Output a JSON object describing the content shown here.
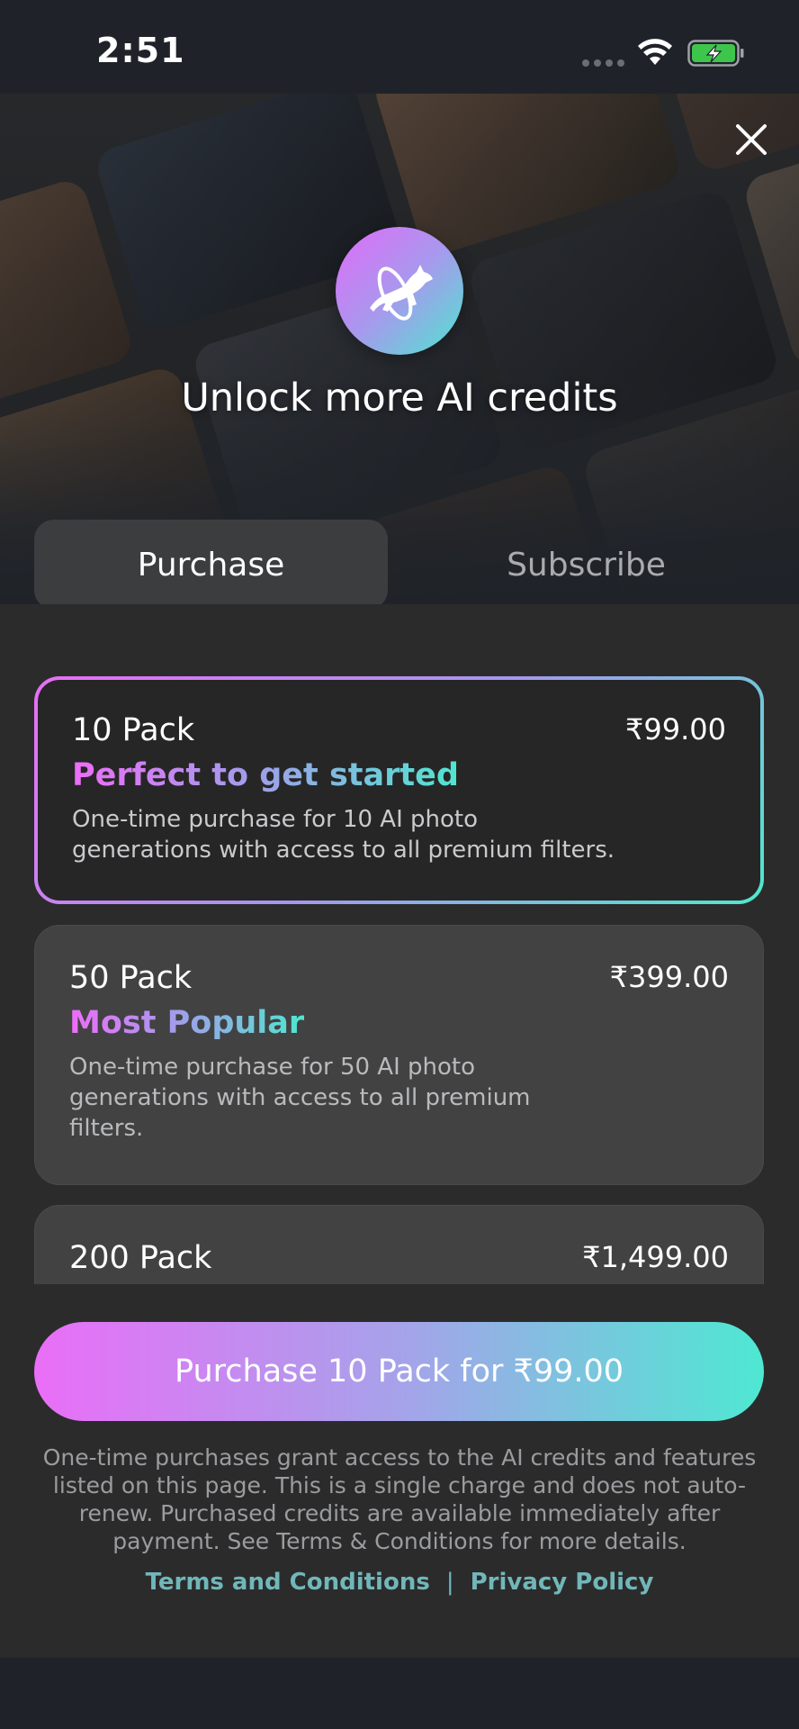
{
  "status_bar": {
    "time": "2:51"
  },
  "hero": {
    "title": "Unlock more AI credits"
  },
  "tabs": [
    {
      "label": "Purchase",
      "selected": true
    },
    {
      "label": "Subscribe",
      "selected": false
    }
  ],
  "packs": [
    {
      "name": "10 Pack",
      "price": "₹99.00",
      "tagline": "Perfect to get started",
      "description": [
        "One-time purchase for 10 AI photo",
        "generations with access to all premium filters."
      ],
      "selected": true
    },
    {
      "name": "50 Pack",
      "price": "₹399.00",
      "tagline": "Most Popular",
      "description": [
        "One-time purchase for 50 AI photo",
        "generations with access to all premium",
        "filters."
      ],
      "selected": false
    },
    {
      "name": "200 Pack",
      "price": "₹1,499.00",
      "selected": false
    }
  ],
  "cta": {
    "label": "Purchase 10 Pack for ₹99.00"
  },
  "disclaimer": [
    "One-time purchases grant access to the AI credits and features",
    "listed on this page. This is a single charge and does not auto-",
    "renew. Purchased credits are available immediately after",
    "payment. See Terms & Conditions for more details."
  ],
  "links": {
    "terms": "Terms and Conditions",
    "separator": "|",
    "privacy": "Privacy Policy"
  },
  "colors": {
    "gradient_start": "#ea6ef7",
    "gradient_mid": "#a6a2ea",
    "gradient_end": "#4ee8d2",
    "link": "#71b7b9",
    "background": "#2b2b2c"
  },
  "icons": {
    "close": "close-icon",
    "logo": "dog-jumping-hoop-icon",
    "wifi": "wifi-icon",
    "battery": "battery-charging-icon",
    "signal": "signal-dots-icon"
  }
}
